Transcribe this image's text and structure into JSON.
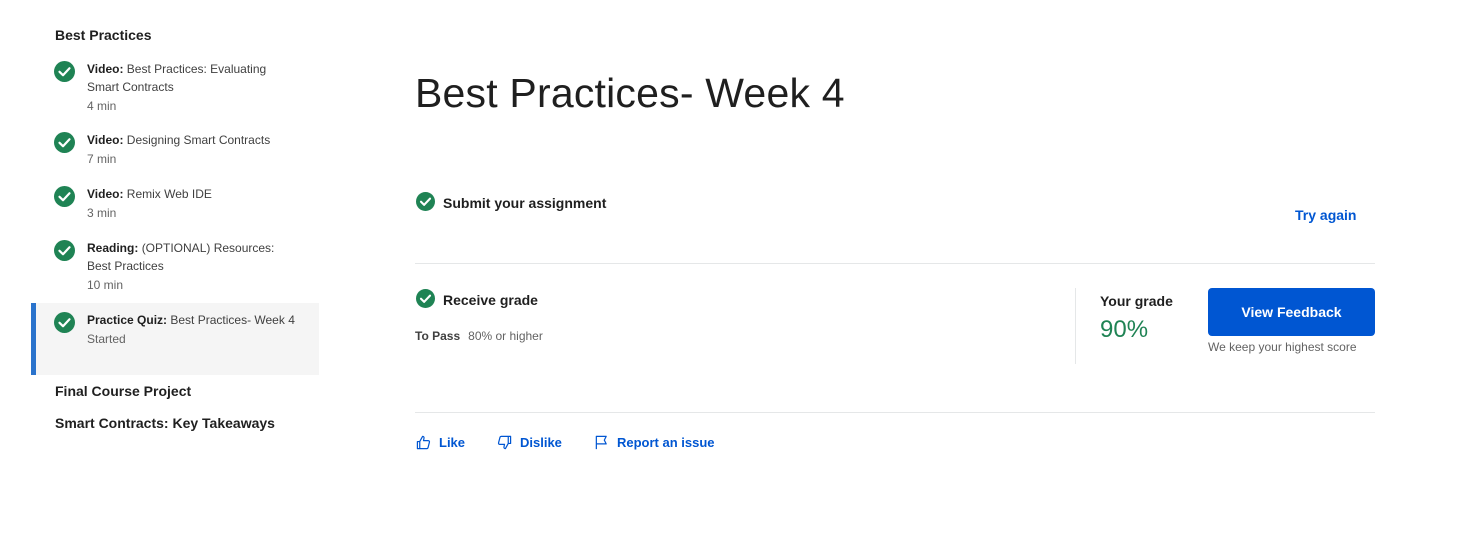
{
  "sidebar": {
    "section_title": "Best Practices",
    "items": [
      {
        "type": "Video:",
        "title": "Best Practices: Evaluating Smart Contracts",
        "meta": "4 min"
      },
      {
        "type": "Video:",
        "title": "Designing Smart Contracts",
        "meta": "7 min"
      },
      {
        "type": "Video:",
        "title": "Remix Web IDE",
        "meta": "3 min"
      },
      {
        "type": "Reading:",
        "title": "(OPTIONAL) Resources: Best Practices",
        "meta": "10 min"
      },
      {
        "type": "Practice Quiz:",
        "title": "Best Practices- Week 4",
        "meta": "Started"
      }
    ],
    "next_sections": [
      "Final Course Project",
      "Smart Contracts: Key Takeaways"
    ]
  },
  "main": {
    "title": "Best Practices- Week 4",
    "submit": {
      "label": "Submit your assignment",
      "action": "Try again"
    },
    "grade": {
      "label": "Receive grade",
      "to_pass_label": "To Pass",
      "to_pass_value": "80% or higher",
      "your_grade_label": "Your grade",
      "your_grade_value": "90%",
      "view_feedback": "View Feedback",
      "note": "We keep your highest score"
    },
    "feedback": {
      "like": "Like",
      "dislike": "Dislike",
      "report": "Report an issue"
    }
  },
  "colors": {
    "accent": "#0056d2",
    "success": "#1f8354",
    "active_bar": "#2a73cc"
  },
  "icons": [
    "check-circle-icon",
    "thumbs-up-icon",
    "thumbs-down-icon",
    "flag-icon"
  ]
}
